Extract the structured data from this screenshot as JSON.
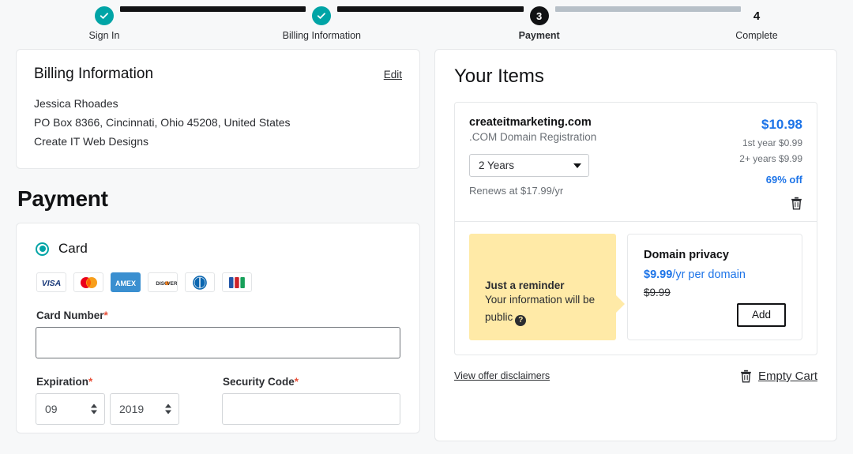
{
  "stepper": {
    "steps": [
      {
        "label": "Sign In",
        "state": "done",
        "marker": "check-icon"
      },
      {
        "label": "Billing Information",
        "state": "done",
        "marker": "check-icon"
      },
      {
        "label": "Payment",
        "state": "current",
        "marker": "3"
      },
      {
        "label": "Complete",
        "state": "future",
        "marker": "4"
      }
    ]
  },
  "billing": {
    "title": "Billing Information",
    "edit_label": "Edit",
    "lines": [
      "Jessica Rhoades",
      "PO Box 8366, Cincinnati, Ohio 45208, United States",
      "Create IT Web Designs"
    ]
  },
  "payment": {
    "heading": "Payment",
    "method_label": "Card",
    "brands": [
      "visa-icon",
      "mastercard-icon",
      "amex-icon",
      "discover-icon",
      "diners-club-icon",
      "jcb-icon"
    ],
    "card_number": {
      "label": "Card Number",
      "required": "*",
      "value": "",
      "placeholder": ""
    },
    "expiration": {
      "label": "Expiration",
      "required": "*",
      "month": "09",
      "year": "2019"
    },
    "security_code": {
      "label": "Security Code",
      "required": "*",
      "value": "",
      "placeholder": ""
    }
  },
  "items": {
    "title": "Your Items",
    "item": {
      "name": "createitmarketing.com",
      "description": ".COM Domain Registration",
      "term": "2 Years",
      "renews": "Renews at $17.99/yr",
      "price": "$10.98",
      "first_year_note": "1st year $0.99",
      "multi_year_note": "2+ years $9.99",
      "discount": "69% off",
      "delete_icon": "trash-icon"
    },
    "reminder": {
      "title": "Just a reminder",
      "body": "Your information will be public",
      "help_icon": "help-icon"
    },
    "privacy": {
      "title": "Domain privacy",
      "price": "$9.99",
      "price_suffix": "/yr per domain",
      "was_price": "$9.99",
      "add_label": "Add"
    },
    "footer": {
      "disclaimer_label": "View offer disclaimers",
      "empty_cart_label": "Empty Cart",
      "empty_cart_icon": "trash-icon"
    }
  },
  "colors": {
    "accent_teal": "#00a4a6",
    "link_blue": "#1d74e8",
    "reminder_yellow": "#ffeaa7",
    "required_red": "#e8503a",
    "ink": "#111214"
  }
}
